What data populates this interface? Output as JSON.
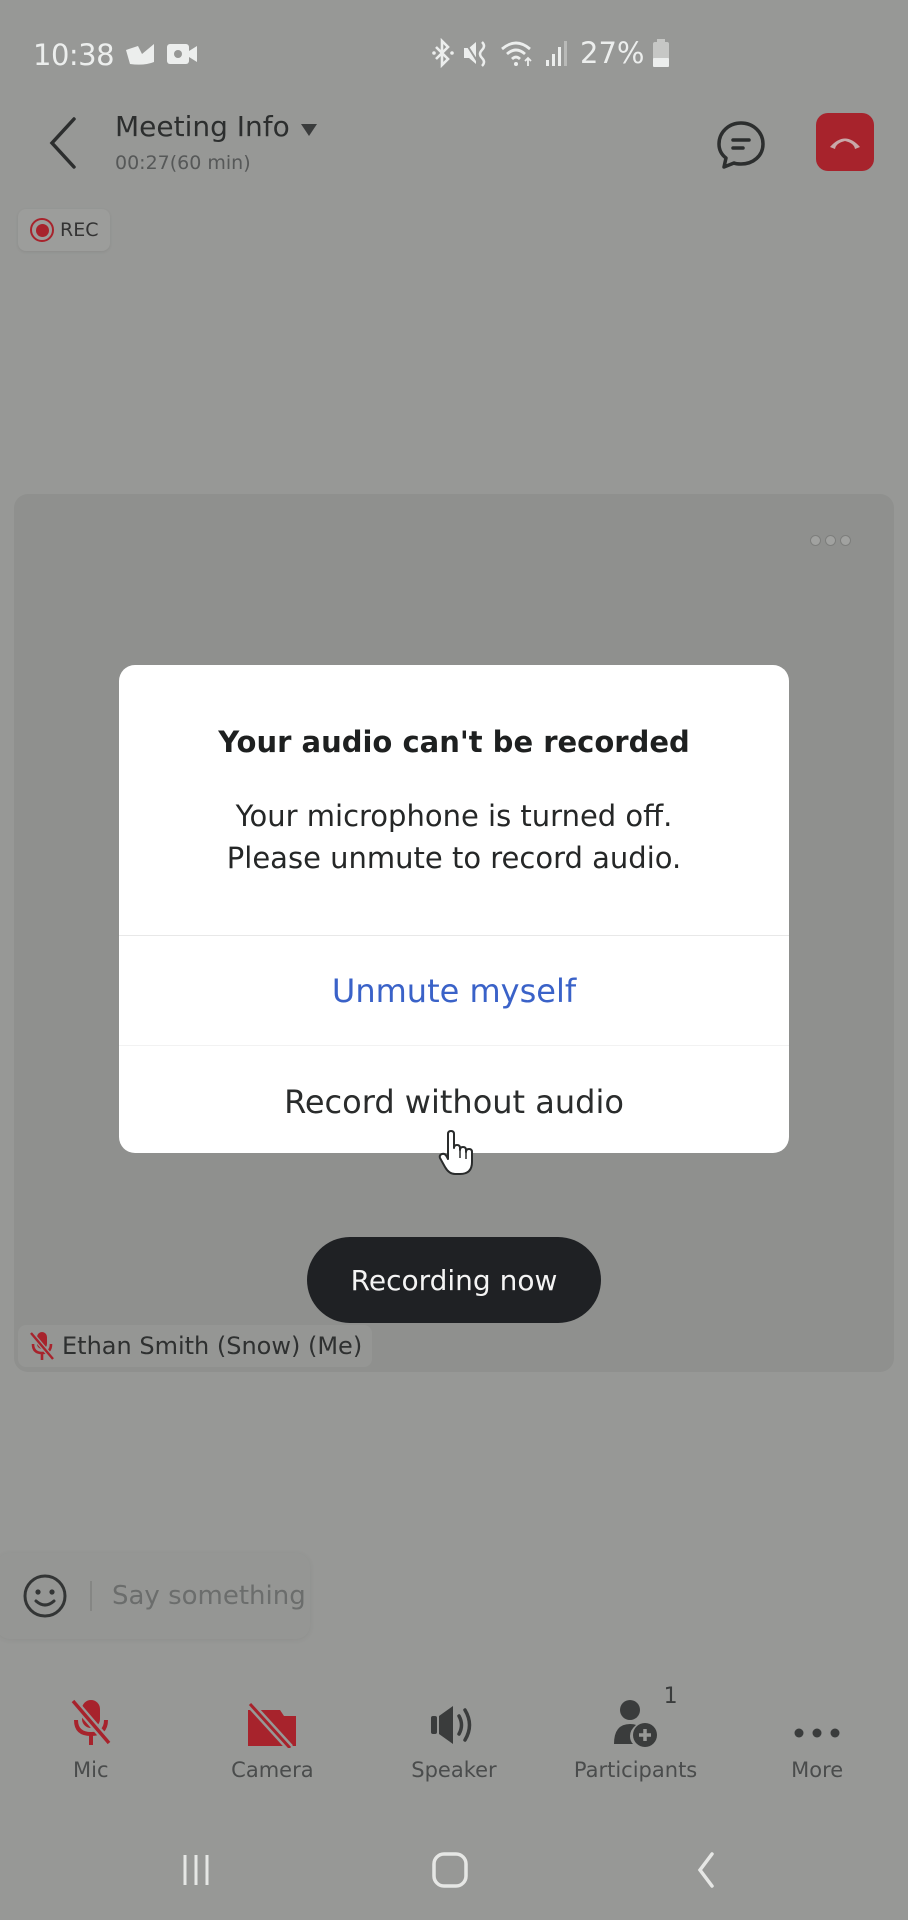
{
  "status_bar": {
    "time": "10:38",
    "battery_percent": "27%",
    "left_icons": [
      "notification-app-icon",
      "video-record-icon"
    ],
    "right_icons": [
      "bluetooth-icon",
      "vibrate-icon",
      "wifi-icon",
      "signal-icon",
      "battery-icon"
    ]
  },
  "header": {
    "back_icon": "chevron-left-icon",
    "title": "Meeting Info",
    "subtitle": "00:27(60 min)",
    "chat_icon": "chat-bubble-icon",
    "end_call_icon": "end-call-icon",
    "end_call_color": "#a7232c"
  },
  "rec_badge": {
    "label": "REC",
    "color": "#a7232c"
  },
  "video_tile": {
    "more_icon": "more-dots-icon",
    "participant_name": "Ethan Smith (Snow) (Me)",
    "participant_muted": true
  },
  "toast": {
    "text": "Recording now"
  },
  "dialog": {
    "title": "Your audio can't be recorded",
    "message_line1": "Your microphone is turned off.",
    "message_line2": "Please unmute to record audio.",
    "primary_button": "Unmute myself",
    "secondary_button": "Record without audio",
    "primary_color": "#3a62c8"
  },
  "chat_input": {
    "placeholder": "Say something",
    "emoji_icon": "smiley-icon"
  },
  "toolbar": {
    "items": [
      {
        "label": "Mic",
        "icon": "mic-off-icon",
        "state": "off"
      },
      {
        "label": "Camera",
        "icon": "camera-off-icon",
        "state": "off"
      },
      {
        "label": "Speaker",
        "icon": "speaker-icon",
        "state": "on"
      },
      {
        "label": "Participants",
        "icon": "participants-add-icon",
        "count": "1"
      },
      {
        "label": "More",
        "icon": "more-horizontal-icon"
      }
    ],
    "off_color": "#a7232c"
  },
  "nav_bar": {
    "items": [
      "recents-icon",
      "home-icon",
      "back-icon"
    ]
  }
}
